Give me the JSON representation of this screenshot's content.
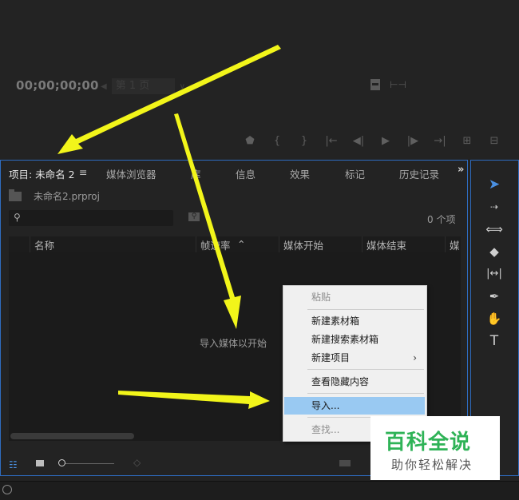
{
  "monitor": {
    "timecode": "00;00;00;00",
    "page_selector": "第 1 页"
  },
  "tabs": [
    {
      "label": "项目: 未命名 2"
    },
    {
      "label": "媒体浏览器"
    },
    {
      "label": "库"
    },
    {
      "label": "信息"
    },
    {
      "label": "效果"
    },
    {
      "label": "标记"
    },
    {
      "label": "历史记录"
    }
  ],
  "project": {
    "filename": "未命名2.prproj",
    "search_placeholder": "",
    "item_count": "0 个项",
    "columns": [
      "名称",
      "帧速率",
      "媒体开始",
      "媒体结束",
      "媒"
    ],
    "empty_hint": "导入媒体以开始"
  },
  "context_menu": {
    "items": [
      {
        "label": "粘贴",
        "state": "disabled"
      },
      {
        "label": "新建素材箱",
        "state": "normal"
      },
      {
        "label": "新建搜索素材箱",
        "state": "normal"
      },
      {
        "label": "新建项目",
        "state": "normal",
        "submenu": "›"
      },
      {
        "label": "查看隐藏内容",
        "state": "normal"
      },
      {
        "label": "导入...",
        "state": "hover"
      },
      {
        "label": "查找...",
        "state": "disabled"
      }
    ]
  },
  "watermark": {
    "title": "百科全说",
    "subtitle": "助你轻松解决"
  },
  "colors": {
    "accent_blue": "#4a90e2",
    "panel_border": "#2e6cc0",
    "arrow_yellow": "#f2f51a",
    "menu_hover": "#99c9f2",
    "watermark_green": "#2fb357"
  },
  "icons": {
    "tools": [
      "selection-tool-icon",
      "track-select-icon",
      "ripple-edit-icon",
      "razor-icon",
      "slip-icon",
      "pen-icon",
      "hand-icon",
      "type-tool-icon"
    ]
  }
}
